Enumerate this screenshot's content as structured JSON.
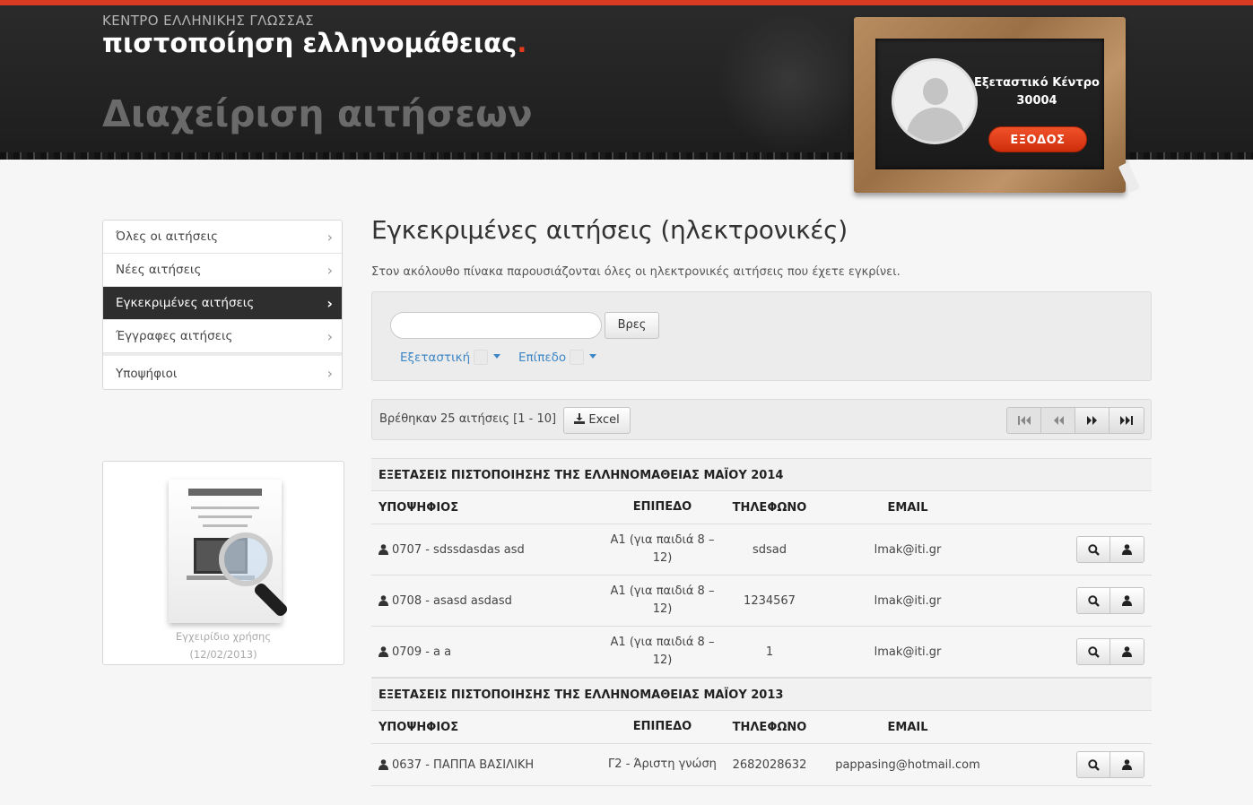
{
  "header": {
    "org_name": "ΚΕΝΤΡΟ ΕΛΛΗΝΙΚΗΣ ΓΛΩΣΣΑΣ",
    "site_title": "πιστοποίηση ελληνομάθειας",
    "site_title_dot": ".",
    "section_title": "Διαχείριση αιτήσεων"
  },
  "profile": {
    "center_label": "Εξεταστικό Κέντρο",
    "center_code": "30004",
    "logout_label": "ΕΞΟΔΟΣ",
    "avatar_icon": "user-silhouette-icon"
  },
  "sidebar": {
    "items": [
      {
        "label": "Όλες οι αιτήσεις"
      },
      {
        "label": "Νέες αιτήσεις"
      },
      {
        "label": "Εγκεκριμένες αιτήσεις"
      },
      {
        "label": "Έγγραφες αιτήσεις"
      },
      {
        "label": "Υποψήφιοι"
      }
    ],
    "chevron_icon": "chevron-right-icon"
  },
  "manual": {
    "title": "Εγχειρίδιο χρήσης",
    "date": "(12/02/2013)"
  },
  "main": {
    "title": "Εγκεκριμένες αιτήσεις (ηλεκτρονικές)",
    "description": "Στον ακόλουθο πίνακα παρουσιάζονται όλες οι ηλεκτρονικές αιτήσεις που έχετε εγκρίνει."
  },
  "filters": {
    "search_value": "",
    "search_placeholder": "",
    "search_button": "Βρες",
    "dropdown_exam": "Εξεταστική",
    "dropdown_level": "Επίπεδο"
  },
  "results": {
    "summary": "Βρέθηκαν 25 αιτήσεις [1 - 10]",
    "excel_label": "Excel",
    "pager_icons": [
      "first-page-icon",
      "previous-page-icon",
      "next-page-icon",
      "last-page-icon"
    ]
  },
  "table": {
    "columns": [
      "ΥΠΟΨΗΦΙΟΣ",
      "ΕΠΙΠΕΔΟ",
      "ΤΗΛΕΦΩΝΟ",
      "EMAIL"
    ],
    "sections": [
      {
        "title": "ΕΞΕΤΑΣΕΙΣ ΠΙΣΤΟΠΟΙΗΣΗΣ ΤΗΣ ΕΛΛΗΝΟΜΑΘΕΙΑΣ ΜΑΪΟΥ 2014",
        "rows": [
          {
            "candidate": "0707 - sdssdasdas asd",
            "level": "Α1 (για παιδιά 8 – 12)",
            "phone": "sdsad",
            "email": "lmak@iti.gr"
          },
          {
            "candidate": "0708 - asasd asdasd",
            "level": "Α1 (για παιδιά 8 – 12)",
            "phone": "1234567",
            "email": "lmak@iti.gr"
          },
          {
            "candidate": "0709 - a a",
            "level": "Α1 (για παιδιά 8 – 12)",
            "phone": "1",
            "email": "lmak@iti.gr"
          }
        ]
      },
      {
        "title": "ΕΞΕΤΑΣΕΙΣ ΠΙΣΤΟΠΟΙΗΣΗΣ ΤΗΣ ΕΛΛΗΝΟΜΑΘΕΙΑΣ ΜΑΪΟΥ 2013",
        "rows": [
          {
            "candidate": "0637 - ΠΑΠΠΑ ΒΑΣΙΛΙΚΗ",
            "level": "Γ2 - Άριστη γνώση",
            "phone": "2682028632",
            "email": "pappasing@hotmail.com"
          }
        ]
      }
    ],
    "row_action_icons": [
      "search-icon",
      "user-icon"
    ]
  },
  "colors": {
    "accent_red": "#d93a22",
    "logout_red": "#e2401a",
    "link_blue": "#3d86c6",
    "active_nav": "#2e2e2e"
  }
}
